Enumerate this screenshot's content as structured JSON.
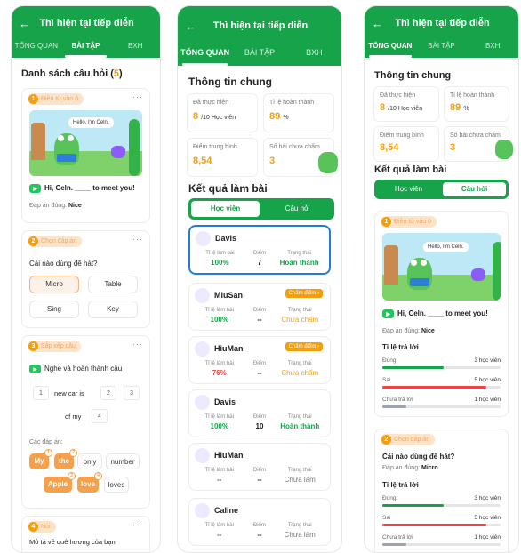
{
  "screen_title": "Thì hiện tại tiếp diễn",
  "tabs": [
    "TỔNG QUAN",
    "BÀI TẬP",
    "BXH"
  ],
  "screen1": {
    "section_prefix": "Danh sách câu hỏi (",
    "question_count": "5",
    "section_suffix": ")",
    "q1": {
      "num": "1",
      "type": "Điền từ vào ô",
      "bubble": "Hello, I'm Celn.",
      "sentence": "Hi, Celn. ____ to meet you!",
      "answer_label": "Đáp án đúng:",
      "answer": "Nice"
    },
    "q2": {
      "num": "2",
      "type": "Chọn đáp án",
      "question": "Cái nào dùng để hát?",
      "options": [
        "Micro",
        "Table",
        "Sing",
        "Key"
      ]
    },
    "q3": {
      "num": "3",
      "type": "Sắp xếp câu",
      "prompt": "Nghe và hoàn thành câu",
      "slots": [
        "1",
        "2",
        "3",
        "4"
      ],
      "fragment1": "new car is",
      "fragment2": "of my",
      "answers_label": "Các đáp án:",
      "chips": [
        "My",
        "the",
        "only",
        "number",
        "Apple",
        "love",
        "loves"
      ],
      "chip_marks": [
        "1",
        "2",
        "3",
        "4"
      ]
    },
    "q4": {
      "num": "4",
      "type": "Nói",
      "prompt": "Mô tả về quê hương của bạn"
    }
  },
  "screen2": {
    "general_title": "Thông tin chung",
    "stats": [
      {
        "label": "Đã thực hiện",
        "value": "8",
        "unit": "/10 Học viên"
      },
      {
        "label": "Tỉ lệ hoàn thành",
        "value": "89",
        "unit": "%"
      },
      {
        "label": "Điểm trung bình",
        "value": "8,54",
        "unit": ""
      },
      {
        "label": "Số bài chưa chấm",
        "value": "3",
        "unit": ""
      }
    ],
    "results_title": "Kết quả làm bài",
    "segments": [
      "Học viên",
      "Câu hỏi"
    ],
    "col_labels": [
      "Tỉ lệ làm bài",
      "Điểm",
      "Trạng thái"
    ],
    "grade_label": "Chấm điểm",
    "students": [
      {
        "name": "Davis",
        "rate": "100%",
        "score": "7",
        "status": "Hoàn thành"
      },
      {
        "name": "MiuSan",
        "rate": "100%",
        "score": "--",
        "status": "Chưa chấm"
      },
      {
        "name": "HiuMan",
        "rate": "76%",
        "score": "--",
        "status": "Chưa chấm"
      },
      {
        "name": "Davis",
        "rate": "100%",
        "score": "10",
        "status": "Hoàn thành"
      },
      {
        "name": "HiuMan",
        "rate": "--",
        "score": "--",
        "status": "Chưa làm"
      },
      {
        "name": "Caline",
        "rate": "--",
        "score": "--",
        "status": "Chưa làm"
      }
    ],
    "colors": {
      "green": "#16a34a",
      "orange": "#f59e0b",
      "red": "#ef4444",
      "blue": "#1e7fd8"
    }
  },
  "screen3": {
    "q1": {
      "num": "1",
      "type": "Điền từ vào ô",
      "bubble": "Hello, I'm Celn.",
      "sentence": "Hi, Celn. ____ to meet you!",
      "answer_label": "Đáp án đúng:",
      "answer": "Nice"
    },
    "ratio_title": "Tỉ lệ trả lời",
    "q1_rows": [
      {
        "label": "Đúng",
        "count": "3 học viên",
        "fraction": 0.52
      },
      {
        "label": "Sai",
        "count": "5 học viên",
        "fraction": 0.88
      },
      {
        "label": "Chưa trả lời",
        "count": "1 học viên",
        "fraction": 0.2
      }
    ],
    "q2": {
      "num": "2",
      "type": "Chọn đáp án",
      "question": "Cái nào dùng để hát?",
      "answer_label": "Đáp án đúng:",
      "answer": "Micro"
    },
    "q2_rows": [
      {
        "label": "Đúng",
        "count": "3 học viên",
        "fraction": 0.52
      },
      {
        "label": "Sai",
        "count": "5 học viên",
        "fraction": 0.88
      },
      {
        "label": "Chưa trả lời",
        "count": "1 học viên",
        "fraction": 0.2
      }
    ]
  }
}
